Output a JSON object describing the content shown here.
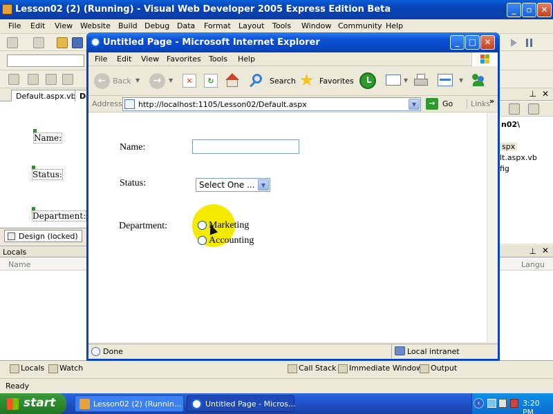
{
  "vwd": {
    "title": "Lesson02 (2) (Running) - Visual Web Developer 2005 Express Edition Beta",
    "menu": [
      "File",
      "Edit",
      "View",
      "Website",
      "Build",
      "Debug",
      "Data",
      "Format",
      "Layout",
      "Tools",
      "Window",
      "Community",
      "Help"
    ],
    "doc_tabs": [
      "Default.aspx.vb",
      "De"
    ],
    "design_labels": [
      "Name:",
      "Status:",
      "Department:"
    ],
    "design_button": "Design (locked)",
    "locals_title": "Locals",
    "locals_col_name": "Name",
    "right_panel_items": [
      "n02\\",
      "spx",
      "lt.aspx.vb",
      "fig"
    ],
    "right_locals_col": "Langu",
    "bottom_tabs": [
      "Locals",
      "Watch",
      "Call Stack",
      "Immediate Window",
      "Output"
    ],
    "status": "Ready"
  },
  "ie": {
    "title": "Untitled Page - Microsoft Internet Explorer",
    "menu": [
      "File",
      "Edit",
      "View",
      "Favorites",
      "Tools",
      "Help"
    ],
    "toolbar": {
      "back": "Back",
      "search": "Search",
      "favorites": "Favorites"
    },
    "address_label": "Address",
    "url": "http://localhost:1105/Lesson02/Default.aspx",
    "go": "Go",
    "links": "Links",
    "status_left": "Done",
    "status_zone": "Local intranet"
  },
  "form": {
    "name_label": "Name:",
    "name_value": "",
    "status_label": "Status:",
    "status_selected": "Select One ...",
    "department_label": "Department:",
    "departments": [
      "Marketing",
      "Accounting"
    ]
  },
  "taskbar": {
    "start": "start",
    "tasks": [
      "Lesson02 (2) (Runnin...",
      "Untitled Page - Micros..."
    ],
    "clock": "3:20 PM"
  },
  "colors": {
    "highlight_spot": "#f4ea00",
    "ie_frame": "#0843c4"
  }
}
